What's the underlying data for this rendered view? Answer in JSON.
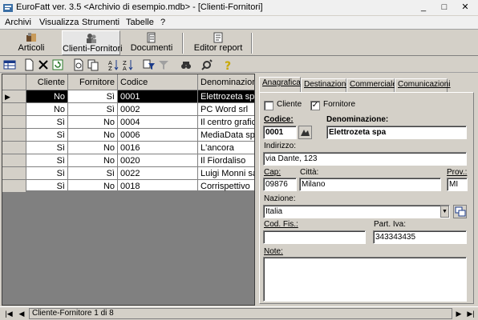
{
  "window": {
    "title": "EuroFatt ver. 3.5 <Archivio di esempio.mdb> - [Clienti-Fornitori]",
    "min": "_",
    "max": "□",
    "close": "✕"
  },
  "menu": [
    "Archivi",
    "Visualizza",
    "Strumenti",
    "Tabelle",
    "?"
  ],
  "big_toolbar": {
    "articoli": "Articoli",
    "clienti": "Clienti-Fornitori",
    "documenti": "Documenti",
    "editor": "Editor report"
  },
  "grid": {
    "headers": [
      "Cliente",
      "Fornitore",
      "Codice",
      "Denominazione"
    ],
    "rows": [
      {
        "cliente": "No",
        "fornitore": "Sì",
        "codice": "0001",
        "denom": "Elettrozeta spa"
      },
      {
        "cliente": "No",
        "fornitore": "Sì",
        "codice": "0002",
        "denom": "PC Word srl"
      },
      {
        "cliente": "Sì",
        "fornitore": "No",
        "codice": "0004",
        "denom": "Il centro grafico"
      },
      {
        "cliente": "Sì",
        "fornitore": "No",
        "codice": "0006",
        "denom": "MediaData spa"
      },
      {
        "cliente": "Sì",
        "fornitore": "No",
        "codice": "0016",
        "denom": "L'ancora"
      },
      {
        "cliente": "Sì",
        "fornitore": "No",
        "codice": "0020",
        "denom": "Il Fiordaliso"
      },
      {
        "cliente": "Sì",
        "fornitore": "Sì",
        "codice": "0022",
        "denom": "Luigi Monni sas"
      },
      {
        "cliente": "Sì",
        "fornitore": "No",
        "codice": "0018",
        "denom": "Corrispettivo"
      }
    ]
  },
  "tabs": [
    "Anagrafica",
    "Destinazione",
    "Commerciale",
    "Comunicazioni"
  ],
  "form": {
    "chk_cliente": "Cliente",
    "chk_fornitore": "Fornitore",
    "cliente_checked": false,
    "fornitore_checked": true,
    "codice_label": "Codice:",
    "codice_value": "0001",
    "denom_label": "Denominazione:",
    "denom_value": "Elettrozeta spa",
    "indirizzo_label": "Indirizzo:",
    "indirizzo_value": "via Dante, 123",
    "cap_label": "Cap:",
    "cap_value": "09876",
    "citta_label": "Città:",
    "citta_value": "Milano",
    "prov_label": "Prov.:",
    "prov_value": "MI",
    "nazione_label": "Nazione:",
    "nazione_value": "Italia",
    "codfis_label": "Cod. Fis.:",
    "codfis_value": "",
    "piva_label": "Part. Iva:",
    "piva_value": "343343435",
    "note_label": "Note:",
    "note_value": ""
  },
  "status": {
    "text": "Cliente-Fornitore 1 di 8"
  }
}
